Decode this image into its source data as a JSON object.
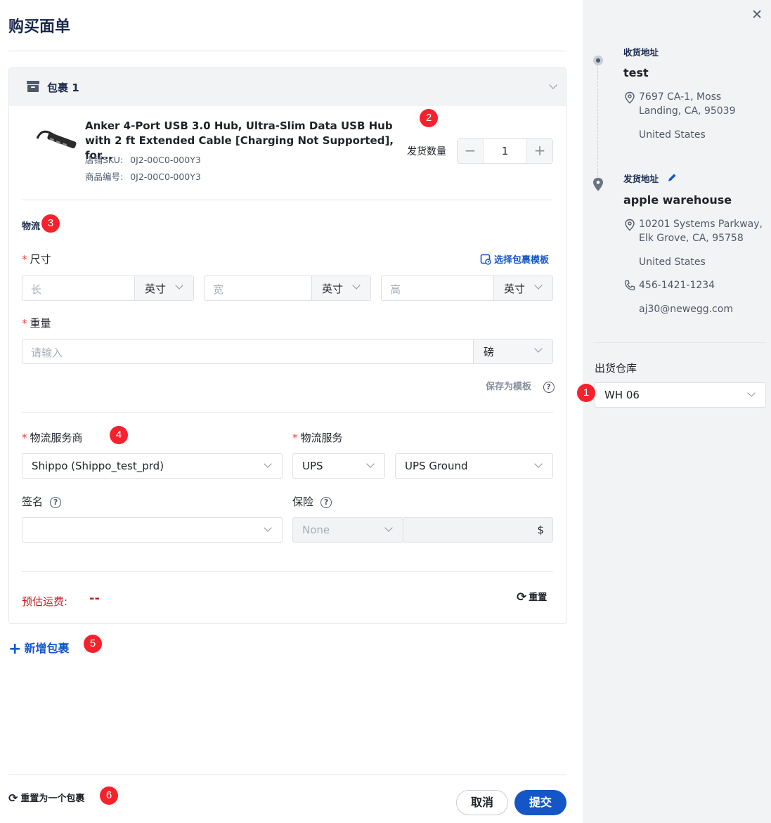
{
  "header": {
    "title": "购买面单",
    "close_symbol": "✕"
  },
  "package": {
    "title": "包裹 1",
    "product": {
      "name": "Anker 4-Port USB 3.0 Hub, Ultra-Slim Data USB Hub with 2 ft Extended Cable [Charging Not Supported], for...",
      "store_sku_label": "店铺SKU:",
      "store_sku": "0J2-00C0-000Y3",
      "item_no_label": "商品编号:",
      "item_no": "0J2-00C0-000Y3"
    },
    "quantity": {
      "label": "发货数量",
      "value": "1",
      "minus": "−",
      "plus": "+"
    },
    "logistics_label": "物流",
    "dimensions": {
      "label": "尺寸",
      "template_link": "选择包裹模板",
      "length_placeholder": "长",
      "width_placeholder": "宽",
      "height_placeholder": "高",
      "unit": "英寸"
    },
    "weight": {
      "label": "重量",
      "placeholder": "请输入",
      "unit": "磅"
    },
    "save_template": "保存为模板",
    "carrier": {
      "label": "物流服务商",
      "value": "Shippo (Shippo_test_prd)"
    },
    "service": {
      "label": "物流服务",
      "carrier_value": "UPS",
      "service_value": "UPS Ground"
    },
    "signature": {
      "label": "签名",
      "value": ""
    },
    "insurance": {
      "label": "保险",
      "option": "None",
      "currency": "$"
    },
    "estimate": {
      "label": "预估运费:",
      "value": "--"
    },
    "reset_label": "重置"
  },
  "add_package": "新增包裹",
  "footer": {
    "reset_one": "重置为一个包裹",
    "cancel": "取消",
    "submit": "提交"
  },
  "side": {
    "ship_to": {
      "label": "收货地址",
      "name": "test",
      "address": "7697 CA-1, Moss Landing, CA, 95039",
      "country": "United States"
    },
    "ship_from": {
      "label": "发货地址",
      "name": "apple warehouse",
      "address": "10201 Systems Parkway, Elk Grove, CA, 95758",
      "country": "United States",
      "phone": "456-1421-1234",
      "email": "aj30@newegg.com"
    },
    "warehouse": {
      "label": "出货仓库",
      "value": "WH 06"
    }
  },
  "badges": [
    "1",
    "2",
    "3",
    "4",
    "5",
    "6"
  ],
  "colors": {
    "primary": "#1456c8",
    "badge": "#f5222d",
    "required": "#f53f3f",
    "estimate": "#c41d1d"
  }
}
